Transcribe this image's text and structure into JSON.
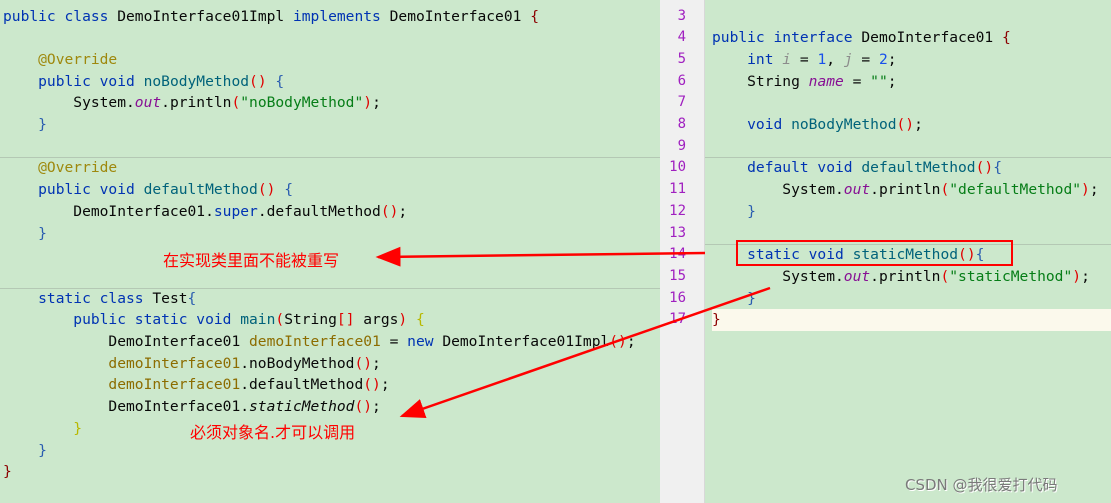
{
  "left_code": [
    [
      [
        "public class ",
        "k"
      ],
      [
        "DemoInterface01Impl ",
        "p"
      ],
      [
        "implements ",
        "k"
      ],
      [
        "DemoInterface01 ",
        "p"
      ],
      [
        "{",
        "ob"
      ]
    ],
    [],
    [
      [
        "    @Override",
        "a"
      ]
    ],
    [
      [
        "    public void ",
        "k"
      ],
      [
        "noBodyMethod",
        "m"
      ],
      [
        "()",
        "r"
      ],
      [
        " {",
        "b"
      ]
    ],
    [
      [
        "        System.",
        "p"
      ],
      [
        "out",
        "f"
      ],
      [
        ".println",
        "p"
      ],
      [
        "(",
        "r"
      ],
      [
        "\"noBodyMethod\"",
        "s"
      ],
      [
        ")",
        "r"
      ],
      [
        ";",
        "p"
      ]
    ],
    [
      [
        "    }",
        "b"
      ]
    ],
    [],
    [
      [
        "    @Override",
        "a"
      ]
    ],
    [
      [
        "    public void ",
        "k"
      ],
      [
        "defaultMethod",
        "m"
      ],
      [
        "()",
        "r"
      ],
      [
        " {",
        "b"
      ]
    ],
    [
      [
        "        DemoInterface01.",
        "p"
      ],
      [
        "super",
        "k"
      ],
      [
        ".defaultMethod",
        "p"
      ],
      [
        "()",
        "r"
      ],
      [
        ";",
        "p"
      ]
    ],
    [
      [
        "    }",
        "b"
      ]
    ],
    [],
    [],
    [
      [
        "    static class ",
        "k"
      ],
      [
        "Test",
        "p"
      ],
      [
        "{",
        "b"
      ]
    ],
    [
      [
        "        public static void ",
        "k"
      ],
      [
        "main",
        "m"
      ],
      [
        "(",
        "r"
      ],
      [
        "String",
        "p"
      ],
      [
        "[]",
        "r"
      ],
      [
        " args",
        "p"
      ],
      [
        ") ",
        "r"
      ],
      [
        "{",
        "y"
      ]
    ],
    [
      [
        "            DemoInterface01 ",
        "p"
      ],
      [
        "demoInterface01",
        "v"
      ],
      [
        " = ",
        "p"
      ],
      [
        "new ",
        "k"
      ],
      [
        "DemoInterface01Impl",
        "p"
      ],
      [
        "()",
        "r"
      ],
      [
        ";",
        "p"
      ]
    ],
    [
      [
        "            demoInterface01",
        "v"
      ],
      [
        ".noBodyMethod",
        "p"
      ],
      [
        "()",
        "r"
      ],
      [
        ";",
        "p"
      ]
    ],
    [
      [
        "            demoInterface01",
        "v"
      ],
      [
        ".defaultMethod",
        "p"
      ],
      [
        "()",
        "r"
      ],
      [
        ";",
        "p"
      ]
    ],
    [
      [
        "            DemoInterface01.",
        "p"
      ],
      [
        "staticMethod",
        "p it"
      ],
      [
        "()",
        "r"
      ],
      [
        ";",
        "p"
      ]
    ],
    [
      [
        "        }",
        "y"
      ]
    ],
    [
      [
        "    }",
        "b"
      ]
    ],
    [
      [
        "}",
        "ob"
      ]
    ]
  ],
  "right_line_numbers": [
    "3",
    "4",
    "5",
    "6",
    "7",
    "8",
    "9",
    "10",
    "11",
    "12",
    "13",
    "14",
    "15",
    "16",
    "17"
  ],
  "right_code": [
    [],
    [
      [
        "public interface ",
        "k"
      ],
      [
        "DemoInterface01 ",
        "p"
      ],
      [
        "{",
        "ob"
      ]
    ],
    [
      [
        "    int ",
        "k"
      ],
      [
        "i",
        "g"
      ],
      [
        " = ",
        "p"
      ],
      [
        "1",
        "n"
      ],
      [
        ", ",
        "p"
      ],
      [
        "j",
        "g"
      ],
      [
        " = ",
        "p"
      ],
      [
        "2",
        "n"
      ],
      [
        ";",
        "p"
      ]
    ],
    [
      [
        "    String ",
        "p"
      ],
      [
        "name",
        "f"
      ],
      [
        " = ",
        "p"
      ],
      [
        "\"\"",
        "s"
      ],
      [
        ";",
        "p"
      ]
    ],
    [],
    [
      [
        "    void ",
        "k"
      ],
      [
        "noBodyMethod",
        "m"
      ],
      [
        "()",
        "r"
      ],
      [
        ";",
        "p"
      ]
    ],
    [],
    [
      [
        "    default void ",
        "k"
      ],
      [
        "defaultMethod",
        "m"
      ],
      [
        "()",
        "r"
      ],
      [
        "{",
        "b"
      ]
    ],
    [
      [
        "        System.",
        "p"
      ],
      [
        "out",
        "f"
      ],
      [
        ".println",
        "p"
      ],
      [
        "(",
        "r"
      ],
      [
        "\"defaultMethod\"",
        "s"
      ],
      [
        ")",
        "r"
      ],
      [
        ";",
        "p"
      ]
    ],
    [
      [
        "    }",
        "b"
      ]
    ],
    [],
    [
      [
        "    static void ",
        "k"
      ],
      [
        "staticMethod",
        "m"
      ],
      [
        "()",
        "r"
      ],
      [
        "{",
        "b"
      ]
    ],
    [
      [
        "        System.",
        "p"
      ],
      [
        "out",
        "f"
      ],
      [
        ".println",
        "p"
      ],
      [
        "(",
        "r"
      ],
      [
        "\"staticMethod\"",
        "s"
      ],
      [
        ")",
        "r"
      ],
      [
        ";",
        "p"
      ]
    ],
    [
      [
        "    }",
        "b"
      ]
    ],
    [
      [
        "}",
        "ob"
      ]
    ]
  ],
  "annotations": {
    "no_override": "在实现类里面不能被重写",
    "call_by_name": "必须对象名.才可以调用"
  },
  "watermark": "CSDN @我很爱打代码",
  "colors": {
    "background": "#cce8cc",
    "annotation_red": "#ff0000",
    "keyword": "#0033b3",
    "string": "#067d17"
  }
}
